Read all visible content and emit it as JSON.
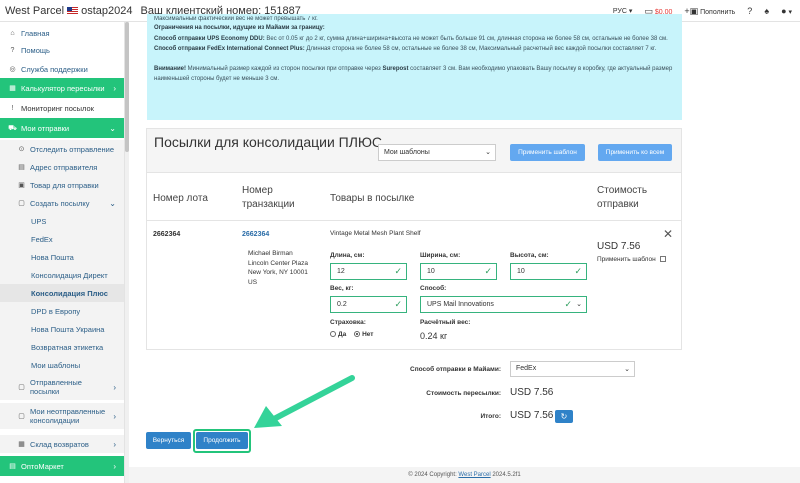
{
  "header": {
    "brand": "West Parcel",
    "user": "ostap2024",
    "client_number": "Ваш клиентский номер: 151887",
    "lang": "РУС",
    "balance": "$0.00",
    "topup": "Пополнить"
  },
  "sidebar": {
    "items": [
      {
        "label": "Главная",
        "icon": "home-icon"
      },
      {
        "label": "Помощь",
        "icon": "help-icon"
      },
      {
        "label": "Служба поддержки",
        "icon": "support-icon"
      },
      {
        "label": "Калькулятор пересылки",
        "icon": "calculator-icon"
      },
      {
        "label": "Мониторинг посылок",
        "icon": "alert-icon"
      },
      {
        "label": "Мои отправки",
        "icon": "cart-icon"
      },
      {
        "label": "Отследить отправление",
        "icon": "track-icon"
      },
      {
        "label": "Адрес отправителя",
        "icon": "address-icon"
      },
      {
        "label": "Товар для отправки",
        "icon": "goods-icon"
      },
      {
        "label": "Создать посылку",
        "icon": "create-icon"
      },
      {
        "label": "UPS"
      },
      {
        "label": "FedEx"
      },
      {
        "label": "Нова Пошта"
      },
      {
        "label": "Консолидация Директ"
      },
      {
        "label": "Консолидация Плюс"
      },
      {
        "label": "DPD в Европу"
      },
      {
        "label": "Нова Пошта Украина"
      },
      {
        "label": "Возвратная этикетка"
      },
      {
        "label": "Мои шаблоны"
      },
      {
        "label": "Отправленные посылки"
      },
      {
        "label": "Мои неотправленные консолидации"
      },
      {
        "label": "Склад возвратов"
      },
      {
        "label": "ОптоМаркет",
        "icon": "market-icon"
      }
    ]
  },
  "info": {
    "line1": "Максимальный фактический вес не может превышать 7 кг.",
    "line2": "Ограничения на посылки, идущие из Майами за границу:",
    "line3_b": "Способ отправки UPS Economy DDU:",
    "line3": " Вес от 0.05 кг до 2 кг, сумма длина+ширина+высота не может быть больше 91 см, длинная сторона не более 58 см, остальные не более 38 см.",
    "line4_b": "Способ отправки FedEx International Connect Plus:",
    "line4": " Длинная сторона не более 58 см, остальные не более 38 см, Максимальный расчетный вес каждой посылки составляет 7 кг.",
    "line5_b": "Внимание!",
    "line5": " Минимальный размер каждой из сторон посылки при отправке через ",
    "line5_b2": "Surepost",
    "line5_2": " составляет 3 см. Вам необходимо упаковать Вашу посылку в коробку, где актуальный размер наименьшей стороны будет не меньше 3 см."
  },
  "card": {
    "title": "Посылки для консолидации ПЛЮС",
    "templates_select": "Мои шаблоны",
    "apply_template": "Применить шаблон",
    "apply_all": "Применить ко всем",
    "columns": [
      "Номер лота",
      "Номер транзакции",
      "Товары в посылке",
      "Стоимость отправки"
    ],
    "row": {
      "lot": "2662364",
      "transaction": "2662364",
      "address": [
        "Michael Birman",
        "Lincoln Center Plaza",
        "New York, NY 10001",
        "US"
      ],
      "item": "Vintage Metal Mesh Plant Shelf",
      "length_label": "Длина, см:",
      "length": "12",
      "width_label": "Ширина, см:",
      "width": "10",
      "height_label": "Высота, см:",
      "height": "10",
      "weight_label": "Вес, кг:",
      "weight": "0.2",
      "method_label": "Способ:",
      "method": "UPS Mail Innovations",
      "insurance_label": "Страховка:",
      "yes": "Да",
      "no": "Нет",
      "calc_weight_label": "Расчётный вес:",
      "calc_weight": "0.24 кг",
      "cost": "USD 7.56",
      "apply_tpl": "Применить шаблон"
    }
  },
  "summary": {
    "ship_method_label": "Способ отправки в Майами:",
    "ship_method": "FedEx",
    "cost_label": "Стоимость пересылки:",
    "cost": "USD 7.56",
    "total_label": "Итого:",
    "total": "USD 7.56"
  },
  "actions": {
    "back": "Вернуться",
    "continue": "Продолжить"
  },
  "footer": {
    "text": "© 2024 Copyright: ",
    "link": "West Parcel",
    "version": " 2024.5.2f1"
  },
  "colors": {
    "green": "#23c47b",
    "blue": "#2f82c8",
    "info_bg": "#c8f4fb"
  }
}
